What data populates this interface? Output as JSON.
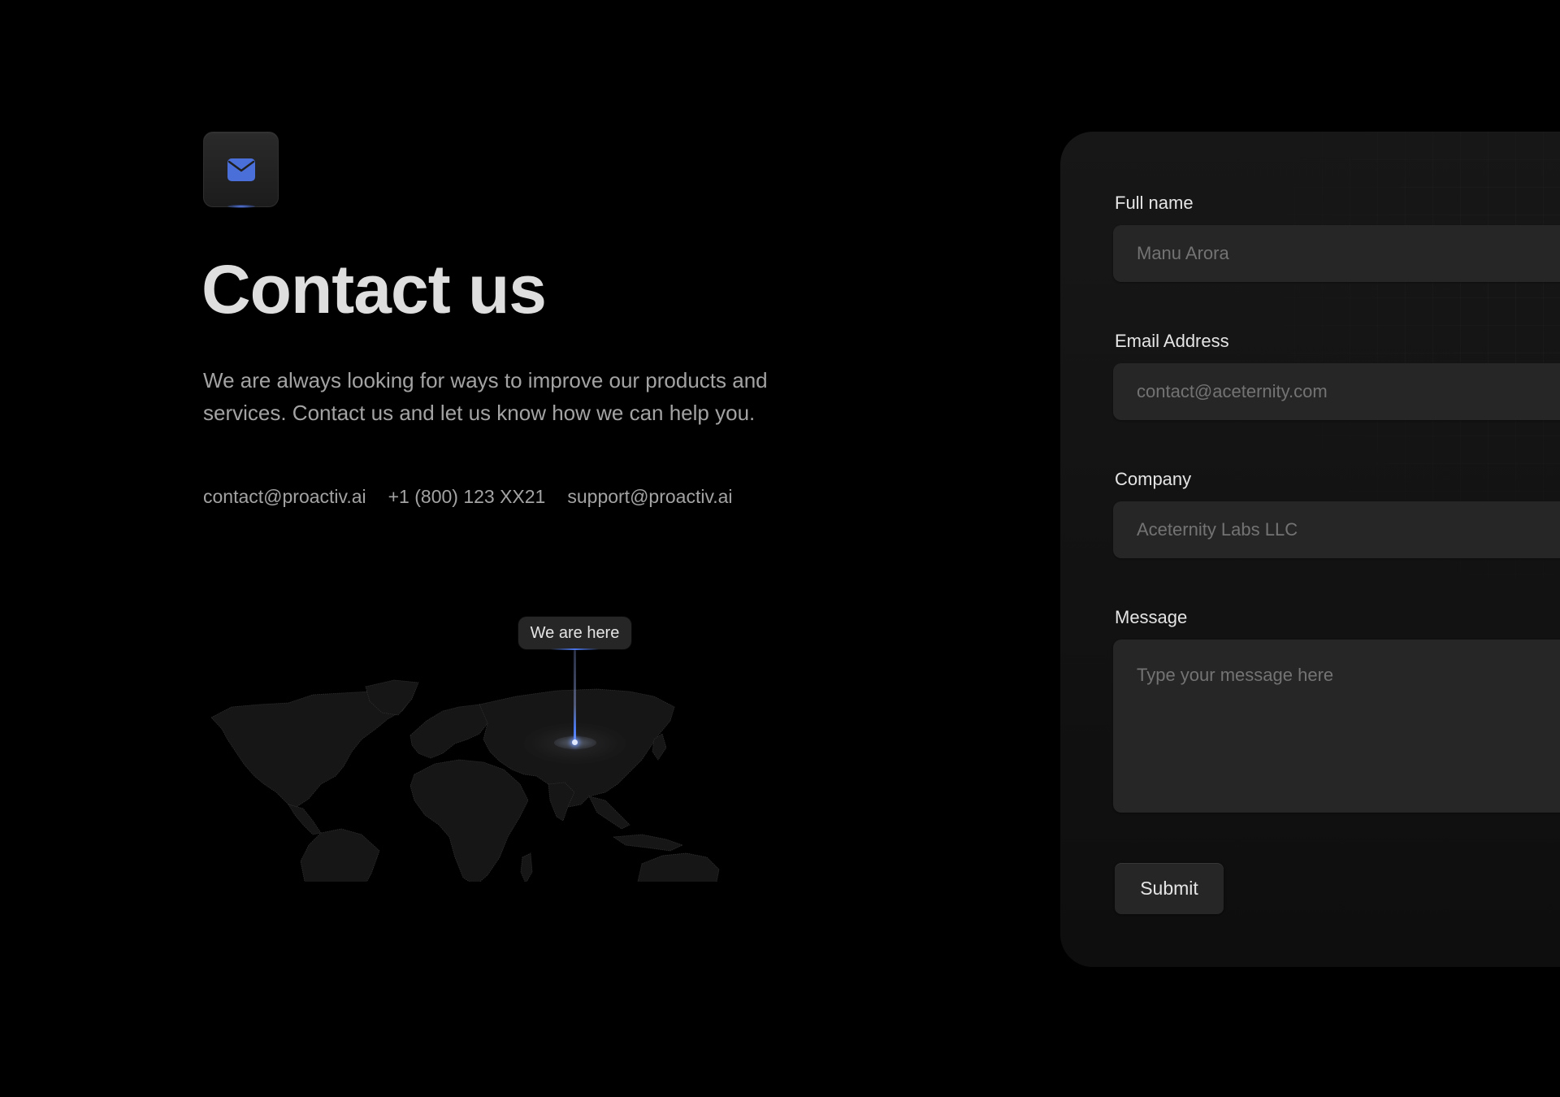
{
  "hero": {
    "icon": "mail-icon",
    "title": "Contact us",
    "description": "We are always looking for ways to improve our products and services. Contact us and let us know how we can help you.",
    "contacts": [
      "contact@proactiv.ai",
      "+1 (800) 123 XX21",
      "support@proactiv.ai"
    ]
  },
  "map": {
    "marker_label": "We are here",
    "accent_color": "#4a76ec"
  },
  "form": {
    "fields": [
      {
        "label": "Full name",
        "placeholder": "Manu Arora",
        "value": ""
      },
      {
        "label": "Email Address",
        "placeholder": "contact@aceternity.com",
        "value": ""
      },
      {
        "label": "Company",
        "placeholder": "Aceternity Labs LLC",
        "value": ""
      },
      {
        "label": "Message",
        "placeholder": "Type your message here",
        "value": ""
      }
    ],
    "submit_label": "Submit"
  },
  "colors": {
    "background": "#000000",
    "panel": "#171717",
    "input": "#262626",
    "icon_accent": "#4a6fd8"
  }
}
